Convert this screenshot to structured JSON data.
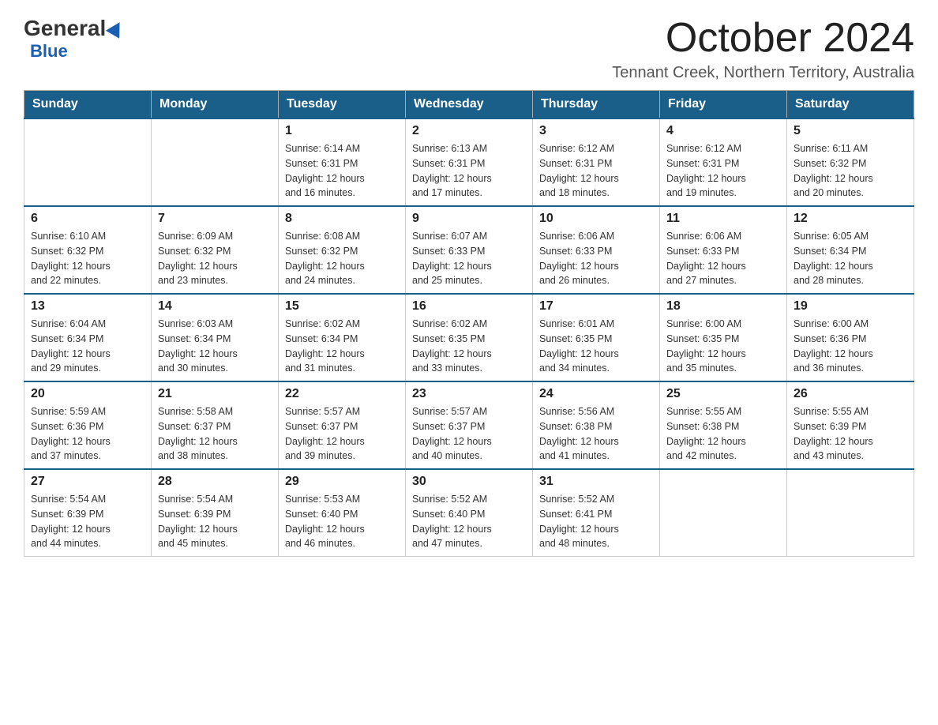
{
  "header": {
    "logo_general": "General",
    "logo_blue": "Blue",
    "month": "October 2024",
    "location": "Tennant Creek, Northern Territory, Australia"
  },
  "days_of_week": [
    "Sunday",
    "Monday",
    "Tuesday",
    "Wednesday",
    "Thursday",
    "Friday",
    "Saturday"
  ],
  "weeks": [
    [
      {
        "day": "",
        "info": ""
      },
      {
        "day": "",
        "info": ""
      },
      {
        "day": "1",
        "info": "Sunrise: 6:14 AM\nSunset: 6:31 PM\nDaylight: 12 hours\nand 16 minutes."
      },
      {
        "day": "2",
        "info": "Sunrise: 6:13 AM\nSunset: 6:31 PM\nDaylight: 12 hours\nand 17 minutes."
      },
      {
        "day": "3",
        "info": "Sunrise: 6:12 AM\nSunset: 6:31 PM\nDaylight: 12 hours\nand 18 minutes."
      },
      {
        "day": "4",
        "info": "Sunrise: 6:12 AM\nSunset: 6:31 PM\nDaylight: 12 hours\nand 19 minutes."
      },
      {
        "day": "5",
        "info": "Sunrise: 6:11 AM\nSunset: 6:32 PM\nDaylight: 12 hours\nand 20 minutes."
      }
    ],
    [
      {
        "day": "6",
        "info": "Sunrise: 6:10 AM\nSunset: 6:32 PM\nDaylight: 12 hours\nand 22 minutes."
      },
      {
        "day": "7",
        "info": "Sunrise: 6:09 AM\nSunset: 6:32 PM\nDaylight: 12 hours\nand 23 minutes."
      },
      {
        "day": "8",
        "info": "Sunrise: 6:08 AM\nSunset: 6:32 PM\nDaylight: 12 hours\nand 24 minutes."
      },
      {
        "day": "9",
        "info": "Sunrise: 6:07 AM\nSunset: 6:33 PM\nDaylight: 12 hours\nand 25 minutes."
      },
      {
        "day": "10",
        "info": "Sunrise: 6:06 AM\nSunset: 6:33 PM\nDaylight: 12 hours\nand 26 minutes."
      },
      {
        "day": "11",
        "info": "Sunrise: 6:06 AM\nSunset: 6:33 PM\nDaylight: 12 hours\nand 27 minutes."
      },
      {
        "day": "12",
        "info": "Sunrise: 6:05 AM\nSunset: 6:34 PM\nDaylight: 12 hours\nand 28 minutes."
      }
    ],
    [
      {
        "day": "13",
        "info": "Sunrise: 6:04 AM\nSunset: 6:34 PM\nDaylight: 12 hours\nand 29 minutes."
      },
      {
        "day": "14",
        "info": "Sunrise: 6:03 AM\nSunset: 6:34 PM\nDaylight: 12 hours\nand 30 minutes."
      },
      {
        "day": "15",
        "info": "Sunrise: 6:02 AM\nSunset: 6:34 PM\nDaylight: 12 hours\nand 31 minutes."
      },
      {
        "day": "16",
        "info": "Sunrise: 6:02 AM\nSunset: 6:35 PM\nDaylight: 12 hours\nand 33 minutes."
      },
      {
        "day": "17",
        "info": "Sunrise: 6:01 AM\nSunset: 6:35 PM\nDaylight: 12 hours\nand 34 minutes."
      },
      {
        "day": "18",
        "info": "Sunrise: 6:00 AM\nSunset: 6:35 PM\nDaylight: 12 hours\nand 35 minutes."
      },
      {
        "day": "19",
        "info": "Sunrise: 6:00 AM\nSunset: 6:36 PM\nDaylight: 12 hours\nand 36 minutes."
      }
    ],
    [
      {
        "day": "20",
        "info": "Sunrise: 5:59 AM\nSunset: 6:36 PM\nDaylight: 12 hours\nand 37 minutes."
      },
      {
        "day": "21",
        "info": "Sunrise: 5:58 AM\nSunset: 6:37 PM\nDaylight: 12 hours\nand 38 minutes."
      },
      {
        "day": "22",
        "info": "Sunrise: 5:57 AM\nSunset: 6:37 PM\nDaylight: 12 hours\nand 39 minutes."
      },
      {
        "day": "23",
        "info": "Sunrise: 5:57 AM\nSunset: 6:37 PM\nDaylight: 12 hours\nand 40 minutes."
      },
      {
        "day": "24",
        "info": "Sunrise: 5:56 AM\nSunset: 6:38 PM\nDaylight: 12 hours\nand 41 minutes."
      },
      {
        "day": "25",
        "info": "Sunrise: 5:55 AM\nSunset: 6:38 PM\nDaylight: 12 hours\nand 42 minutes."
      },
      {
        "day": "26",
        "info": "Sunrise: 5:55 AM\nSunset: 6:39 PM\nDaylight: 12 hours\nand 43 minutes."
      }
    ],
    [
      {
        "day": "27",
        "info": "Sunrise: 5:54 AM\nSunset: 6:39 PM\nDaylight: 12 hours\nand 44 minutes."
      },
      {
        "day": "28",
        "info": "Sunrise: 5:54 AM\nSunset: 6:39 PM\nDaylight: 12 hours\nand 45 minutes."
      },
      {
        "day": "29",
        "info": "Sunrise: 5:53 AM\nSunset: 6:40 PM\nDaylight: 12 hours\nand 46 minutes."
      },
      {
        "day": "30",
        "info": "Sunrise: 5:52 AM\nSunset: 6:40 PM\nDaylight: 12 hours\nand 47 minutes."
      },
      {
        "day": "31",
        "info": "Sunrise: 5:52 AM\nSunset: 6:41 PM\nDaylight: 12 hours\nand 48 minutes."
      },
      {
        "day": "",
        "info": ""
      },
      {
        "day": "",
        "info": ""
      }
    ]
  ]
}
